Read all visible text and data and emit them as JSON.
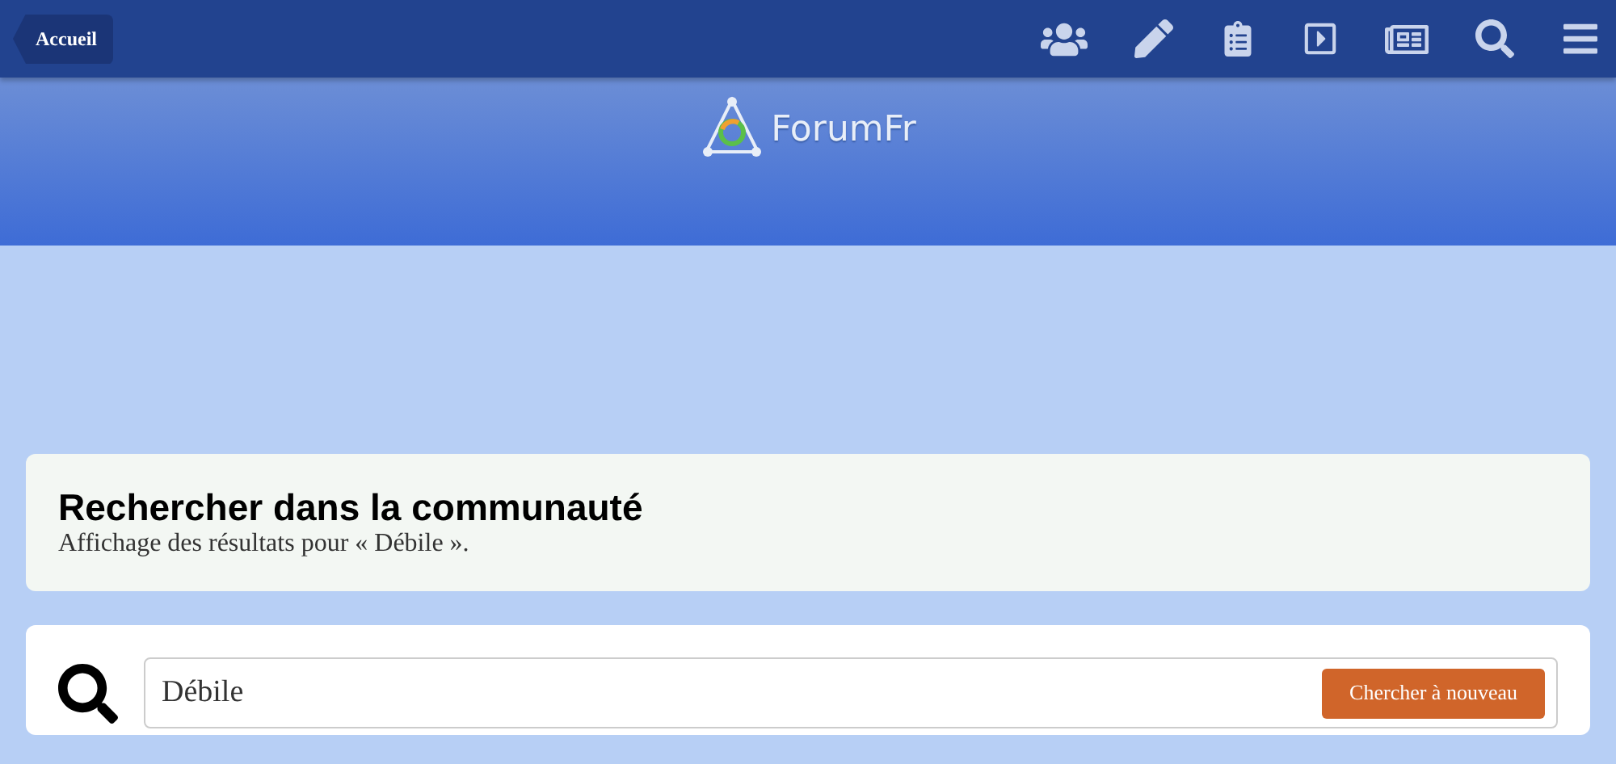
{
  "header": {
    "back_link": "Accueil"
  },
  "banner": {
    "logo_text": "ForumFr"
  },
  "search_header": {
    "title": "Rechercher dans la communauté",
    "subtitle": "Affichage des résultats pour « Débile »."
  },
  "search_form": {
    "value": "Débile",
    "button": "Chercher à nouveau"
  }
}
